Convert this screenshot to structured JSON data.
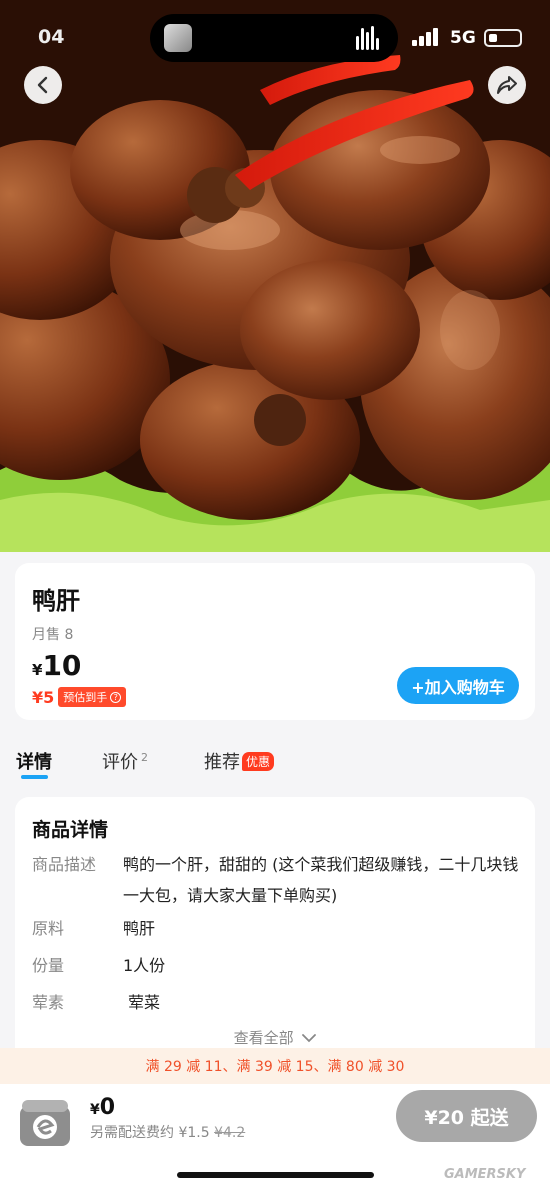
{
  "status_bar": {
    "time": "04",
    "network": "5G"
  },
  "nav": {
    "back_icon": "back-arrow-icon",
    "share_icon": "share-icon"
  },
  "product": {
    "name": "鸭肝",
    "monthly_sales": "月售 8",
    "price_symbol": "¥",
    "price": "10",
    "estimated_price": "¥5",
    "estimated_label": "预估到手",
    "estimated_help": "?",
    "add_to_cart": "+加入购物车"
  },
  "tabs": [
    {
      "label": "详情",
      "active": true
    },
    {
      "label": "评价",
      "count": "2"
    },
    {
      "label": "推荐",
      "badge": "优惠"
    }
  ],
  "details": {
    "title": "商品详情",
    "rows": [
      {
        "label": "商品描述",
        "value": "鸭的一个肝，甜甜的 (这个菜我们超级赚钱，二十几块钱一大包，请大家大量下单购买)"
      },
      {
        "label": "原料",
        "value": "鸭肝"
      },
      {
        "label": "份量",
        "value": "1人份"
      },
      {
        "label": "荤素",
        "value": "荤菜"
      }
    ],
    "view_all": "查看全部"
  },
  "promo": "满 29 减 11、满 39 减 15、满 80 减 30",
  "bottom_bar": {
    "cart_symbol": "¥",
    "cart_total": "0",
    "delivery_prefix": "另需配送费约 ¥1.5",
    "delivery_original": "¥4.2",
    "min_order_label": "¥20 起送"
  },
  "watermark": "GAMERSKY",
  "colors": {
    "accent": "#1ca3f5",
    "promo": "#f0512a",
    "price_red": "#ff3b1f",
    "disabled": "#a8a8a8"
  }
}
